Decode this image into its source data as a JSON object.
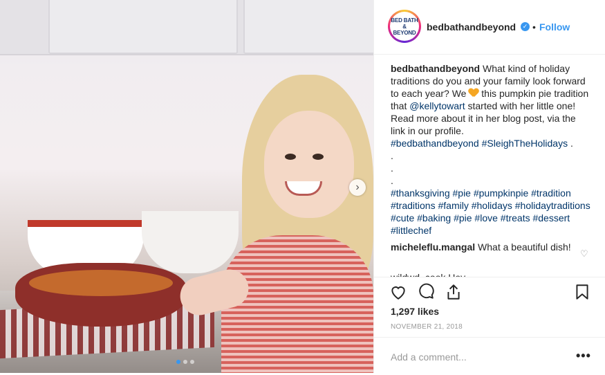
{
  "post": {
    "username": "bedbathandbeyond",
    "logo_lines": [
      "BED BATH &",
      "BEYOND"
    ],
    "verified_icon": "verified-badge-icon",
    "separator": "•",
    "follow_label": "Follow"
  },
  "caption": {
    "author": "bedbathandbeyond",
    "text_1": " What kind of holiday traditions do you and your family look forward to each year? We ",
    "emoji": "orange-heart-emoji",
    "text_2": " this pumpkin pie tradition that ",
    "mention": "@kellytowart",
    "text_3": " started with her little one! Read more about it in her blog post, via the link in our profile.",
    "hashtags_1": "#bedbathandbeyond #SleighTheHolidays",
    "trailing_dot": " .",
    "dot_lines": [
      ".",
      ".",
      "."
    ],
    "hashtags_2": "#thanksgiving #pie #pumpkinpie #tradition #traditions #family #holidays #holidaytraditions #cute #baking #pie #love #treats #dessert #littlechef"
  },
  "comments": [
    {
      "author": "micheleflu.mangal",
      "text": " What a beautiful dish!"
    }
  ],
  "peek_text": "wildwd_cook Hey",
  "actions": {
    "likes": "1,297 likes",
    "date": "NOVEMBER 21, 2018",
    "add_comment_placeholder": "Add a comment...",
    "more_label": "•••"
  },
  "carousel": {
    "dots": 3,
    "active_index": 0,
    "next_label": "›"
  },
  "colors": {
    "link": "#003569",
    "accent": "#3897f0",
    "text": "#262626",
    "muted": "#999999"
  }
}
